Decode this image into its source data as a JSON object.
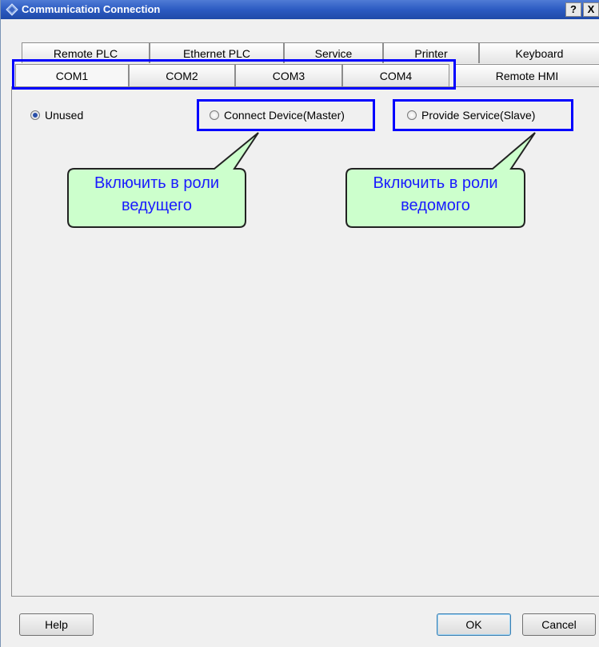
{
  "window": {
    "title": "Communication Connection",
    "help_glyph": "?",
    "close_glyph": "X"
  },
  "tabs_row1": [
    "Remote PLC",
    "Ethernet PLC",
    "Service",
    "Printer",
    "Keyboard"
  ],
  "tabs_row2": [
    "COM1",
    "COM2",
    "COM3",
    "COM4",
    "Remote HMI"
  ],
  "radios": {
    "unused": {
      "label": "Unused",
      "checked": true
    },
    "master": {
      "label": "Connect Device(Master)",
      "checked": false
    },
    "slave": {
      "label": "Provide Service(Slave)",
      "checked": false
    }
  },
  "callouts": {
    "master": {
      "line1": "Включить в роли",
      "line2": "ведущего"
    },
    "slave": {
      "line1": "Включить в роли",
      "line2": "ведомого"
    }
  },
  "buttons": {
    "help": "Help",
    "ok": "OK",
    "cancel": "Cancel"
  },
  "colors": {
    "highlight": "#0000ff",
    "callout_fill": "#ccffcc",
    "callout_text": "#1a1aff",
    "titlebar": "#2c5bc2"
  }
}
